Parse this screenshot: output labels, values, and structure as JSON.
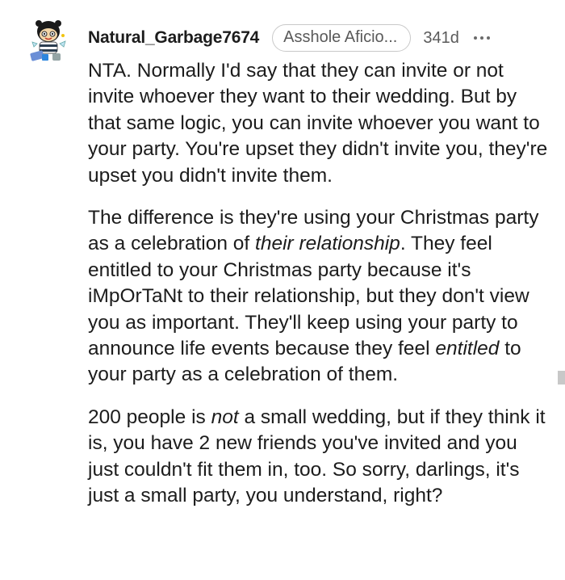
{
  "comment": {
    "username": "Natural_Garbage7674",
    "flair": "Asshole Aficio...",
    "age": "341d",
    "paragraphs": [
      {
        "segments": [
          {
            "text": "NTA. Normally I'd say that they can invite or not invite whoever they want to their wedding. But by that same logic, you can invite whoever you want to your party. You're upset they didn't invite you, they're upset you didn't invite them.",
            "italic": false
          }
        ]
      },
      {
        "segments": [
          {
            "text": "The difference is they're using your Christmas party as a celebration of ",
            "italic": false
          },
          {
            "text": "their relationship",
            "italic": true
          },
          {
            "text": ". They feel entitled to your Christmas party because it's iMpOrTaNt to their relationship, but they don't view you as important. They'll keep using your party to announce life events because they feel ",
            "italic": false
          },
          {
            "text": "entitled",
            "italic": true
          },
          {
            "text": " to your party as a celebration of them.",
            "italic": false
          }
        ]
      },
      {
        "segments": [
          {
            "text": "200 people is ",
            "italic": false
          },
          {
            "text": "not",
            "italic": true
          },
          {
            "text": " a small wedding, but if they think it is, you have 2 new friends you've invited and you just couldn't fit them in, too. So sorry, darlings, it's just a small party, you understand, right?",
            "italic": false
          }
        ]
      }
    ]
  },
  "icons": {
    "avatar": "snoo-avatar-icon",
    "more": "more-options-icon"
  },
  "colors": {
    "text": "#1c1c1c",
    "meta": "#5a5a5a",
    "flair_border": "#c9c9c9",
    "scroll_indicator": "#c8c8c8"
  }
}
